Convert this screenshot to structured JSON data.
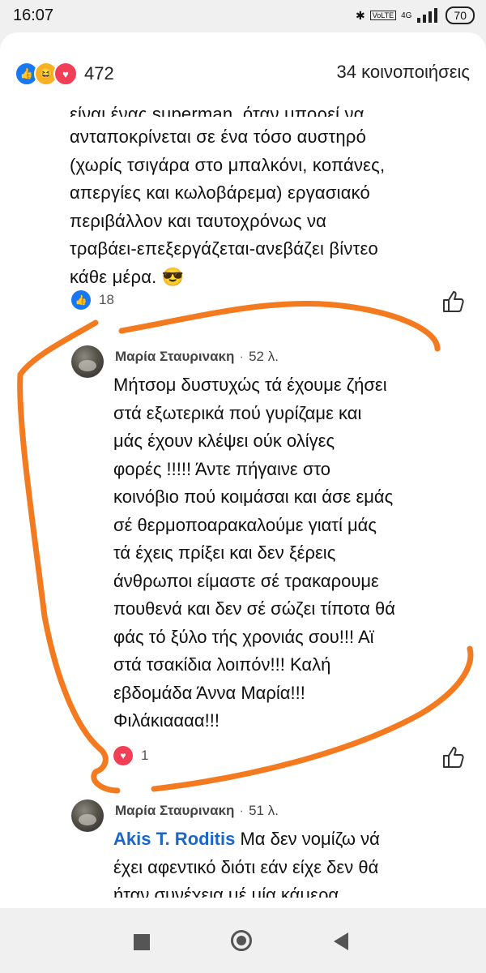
{
  "status_bar": {
    "time": "16:07",
    "bluetooth": "✱",
    "volte": "VoLTE",
    "network": "4G",
    "battery": "70"
  },
  "post": {
    "reaction_count": "472",
    "shares": "34 κοινοποιήσεις",
    "text_clipped": "είναι ένας superman, όταν μπορεί να",
    "text_lines": [
      "ανταποκρίνεται σε ένα τόσο αυστηρό",
      "(χωρίς τσιγάρα στο μπαλκόνι, κοπάνες,",
      "απεργίες και κωλοβάρεμα) εργασιακό",
      "περιβάλλον και ταυτοχρόνως να",
      "τραβάει-επεξεργάζεται-ανεβάζει βίντεο",
      "κάθε μέρα. 😎"
    ],
    "like_count": "18"
  },
  "comment1": {
    "author": "Μαρία Σταυρινακη",
    "time": "52 λ.",
    "lines": [
      "Μήτσομ δυστυχώς τά έχουμε ζήσει",
      "στά εξωτερικά πού γυρίζαμε και",
      "μάς έχουν κλέψει ούκ ολίγες",
      "φορές !!!!! Άντε πήγαινε στο",
      "κοινόβιο πού κοιμάσαι και άσε εμάς",
      "σέ θερμοποαρακαλούμε γιατί μάς",
      "τά έχεις πρίξει και δεν ξέρεις",
      "άνθρωποι είμαστε σέ τρακαρουμε",
      "πουθενά και δεν σέ σώζει τίποτα θά",
      "φάς τό ξύλο τής χρονιάς σου!!! Αϊ",
      "στά τσακίδια λοιπόν!!! Καλή",
      "εβδομάδα Άννα Μαρία!!!",
      "Φιλάκιαααα!!!"
    ],
    "love_count": "1"
  },
  "comment2": {
    "author": "Μαρία Σταυρινακη",
    "time": "51 λ.",
    "mention": "Akis T. Roditis",
    "line1_rest": " Μα δεν νομίζω νά",
    "line2": "έχει αφεντικό διότι εάν είχε δεν θά",
    "line3_clipped": "ήταν συνέχεια μέ μία κάμερα"
  },
  "colors": {
    "like_blue": "#1877f2",
    "love_red": "#f33e58",
    "mention_blue": "#1a66c9",
    "annotation_orange": "#f47a20"
  },
  "icons": [
    "like-icon",
    "haha-icon",
    "love-icon",
    "thumb-up-outline-icon",
    "nav-recents-icon",
    "nav-home-icon",
    "nav-back-icon"
  ]
}
